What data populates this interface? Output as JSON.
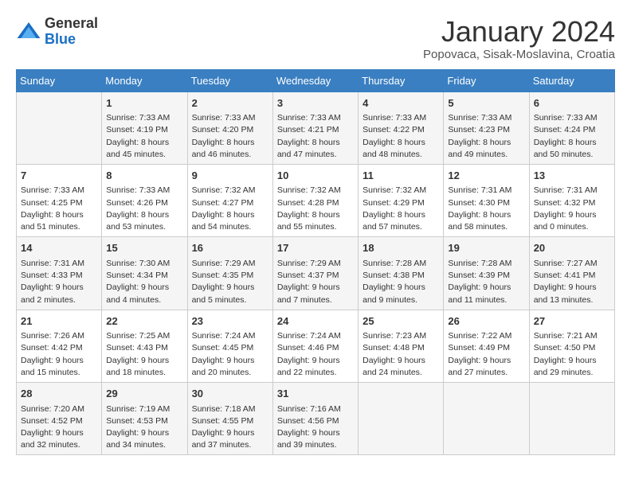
{
  "header": {
    "logo_general": "General",
    "logo_blue": "Blue",
    "title": "January 2024",
    "subtitle": "Popovaca, Sisak-Moslavina, Croatia"
  },
  "days_of_week": [
    "Sunday",
    "Monday",
    "Tuesday",
    "Wednesday",
    "Thursday",
    "Friday",
    "Saturday"
  ],
  "weeks": [
    [
      {
        "day": "",
        "info": ""
      },
      {
        "day": "1",
        "info": "Sunrise: 7:33 AM\nSunset: 4:19 PM\nDaylight: 8 hours\nand 45 minutes."
      },
      {
        "day": "2",
        "info": "Sunrise: 7:33 AM\nSunset: 4:20 PM\nDaylight: 8 hours\nand 46 minutes."
      },
      {
        "day": "3",
        "info": "Sunrise: 7:33 AM\nSunset: 4:21 PM\nDaylight: 8 hours\nand 47 minutes."
      },
      {
        "day": "4",
        "info": "Sunrise: 7:33 AM\nSunset: 4:22 PM\nDaylight: 8 hours\nand 48 minutes."
      },
      {
        "day": "5",
        "info": "Sunrise: 7:33 AM\nSunset: 4:23 PM\nDaylight: 8 hours\nand 49 minutes."
      },
      {
        "day": "6",
        "info": "Sunrise: 7:33 AM\nSunset: 4:24 PM\nDaylight: 8 hours\nand 50 minutes."
      }
    ],
    [
      {
        "day": "7",
        "info": "Sunrise: 7:33 AM\nSunset: 4:25 PM\nDaylight: 8 hours\nand 51 minutes."
      },
      {
        "day": "8",
        "info": "Sunrise: 7:33 AM\nSunset: 4:26 PM\nDaylight: 8 hours\nand 53 minutes."
      },
      {
        "day": "9",
        "info": "Sunrise: 7:32 AM\nSunset: 4:27 PM\nDaylight: 8 hours\nand 54 minutes."
      },
      {
        "day": "10",
        "info": "Sunrise: 7:32 AM\nSunset: 4:28 PM\nDaylight: 8 hours\nand 55 minutes."
      },
      {
        "day": "11",
        "info": "Sunrise: 7:32 AM\nSunset: 4:29 PM\nDaylight: 8 hours\nand 57 minutes."
      },
      {
        "day": "12",
        "info": "Sunrise: 7:31 AM\nSunset: 4:30 PM\nDaylight: 8 hours\nand 58 minutes."
      },
      {
        "day": "13",
        "info": "Sunrise: 7:31 AM\nSunset: 4:32 PM\nDaylight: 9 hours\nand 0 minutes."
      }
    ],
    [
      {
        "day": "14",
        "info": "Sunrise: 7:31 AM\nSunset: 4:33 PM\nDaylight: 9 hours\nand 2 minutes."
      },
      {
        "day": "15",
        "info": "Sunrise: 7:30 AM\nSunset: 4:34 PM\nDaylight: 9 hours\nand 4 minutes."
      },
      {
        "day": "16",
        "info": "Sunrise: 7:29 AM\nSunset: 4:35 PM\nDaylight: 9 hours\nand 5 minutes."
      },
      {
        "day": "17",
        "info": "Sunrise: 7:29 AM\nSunset: 4:37 PM\nDaylight: 9 hours\nand 7 minutes."
      },
      {
        "day": "18",
        "info": "Sunrise: 7:28 AM\nSunset: 4:38 PM\nDaylight: 9 hours\nand 9 minutes."
      },
      {
        "day": "19",
        "info": "Sunrise: 7:28 AM\nSunset: 4:39 PM\nDaylight: 9 hours\nand 11 minutes."
      },
      {
        "day": "20",
        "info": "Sunrise: 7:27 AM\nSunset: 4:41 PM\nDaylight: 9 hours\nand 13 minutes."
      }
    ],
    [
      {
        "day": "21",
        "info": "Sunrise: 7:26 AM\nSunset: 4:42 PM\nDaylight: 9 hours\nand 15 minutes."
      },
      {
        "day": "22",
        "info": "Sunrise: 7:25 AM\nSunset: 4:43 PM\nDaylight: 9 hours\nand 18 minutes."
      },
      {
        "day": "23",
        "info": "Sunrise: 7:24 AM\nSunset: 4:45 PM\nDaylight: 9 hours\nand 20 minutes."
      },
      {
        "day": "24",
        "info": "Sunrise: 7:24 AM\nSunset: 4:46 PM\nDaylight: 9 hours\nand 22 minutes."
      },
      {
        "day": "25",
        "info": "Sunrise: 7:23 AM\nSunset: 4:48 PM\nDaylight: 9 hours\nand 24 minutes."
      },
      {
        "day": "26",
        "info": "Sunrise: 7:22 AM\nSunset: 4:49 PM\nDaylight: 9 hours\nand 27 minutes."
      },
      {
        "day": "27",
        "info": "Sunrise: 7:21 AM\nSunset: 4:50 PM\nDaylight: 9 hours\nand 29 minutes."
      }
    ],
    [
      {
        "day": "28",
        "info": "Sunrise: 7:20 AM\nSunset: 4:52 PM\nDaylight: 9 hours\nand 32 minutes."
      },
      {
        "day": "29",
        "info": "Sunrise: 7:19 AM\nSunset: 4:53 PM\nDaylight: 9 hours\nand 34 minutes."
      },
      {
        "day": "30",
        "info": "Sunrise: 7:18 AM\nSunset: 4:55 PM\nDaylight: 9 hours\nand 37 minutes."
      },
      {
        "day": "31",
        "info": "Sunrise: 7:16 AM\nSunset: 4:56 PM\nDaylight: 9 hours\nand 39 minutes."
      },
      {
        "day": "",
        "info": ""
      },
      {
        "day": "",
        "info": ""
      },
      {
        "day": "",
        "info": ""
      }
    ]
  ]
}
